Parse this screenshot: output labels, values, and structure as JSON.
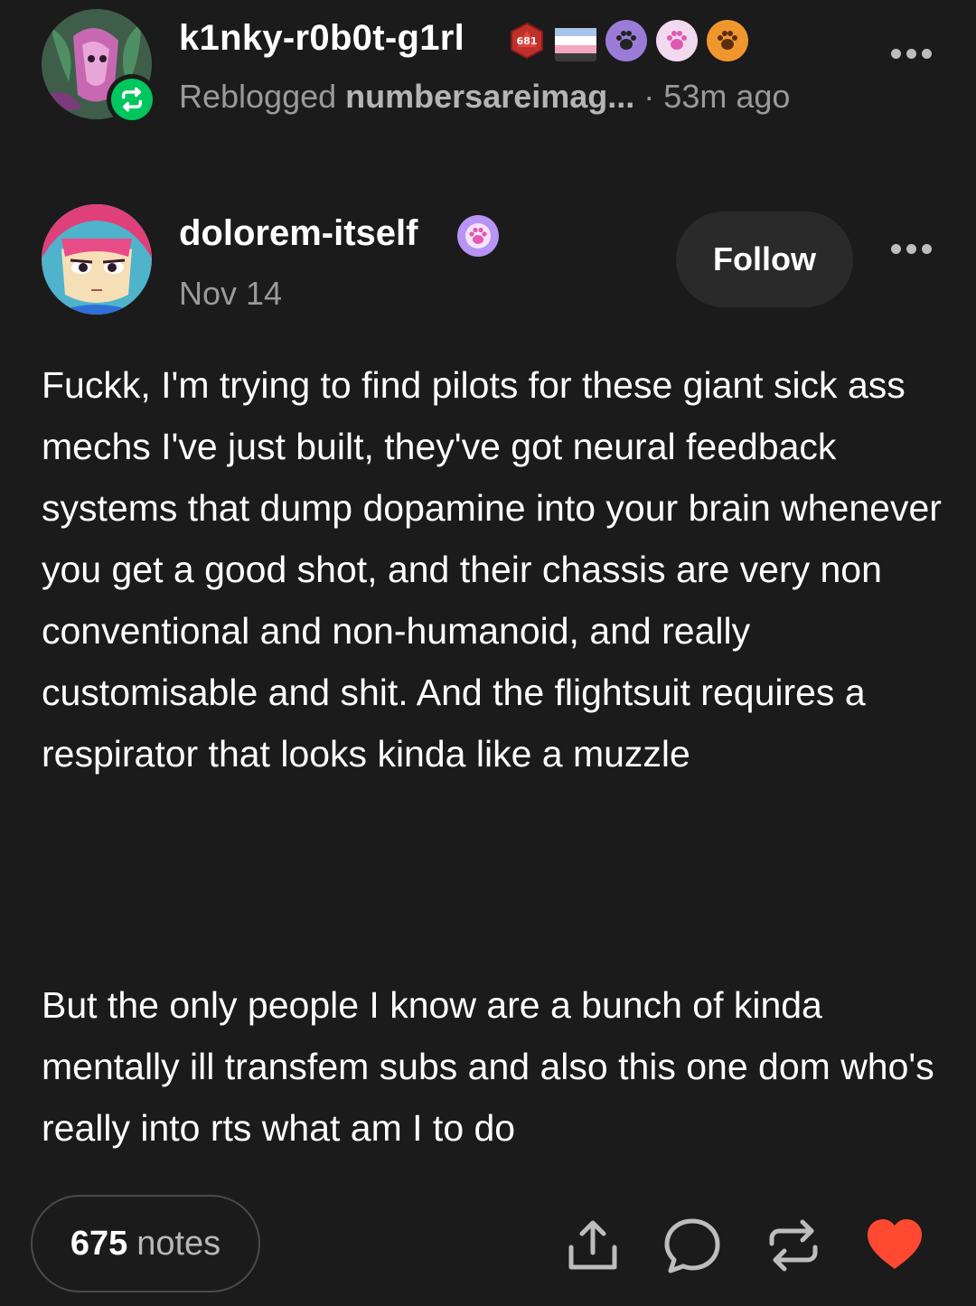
{
  "reblog_header": {
    "blog_name": "k1nky-r0b0t-g1rl",
    "reblogged_prefix": "Reblogged",
    "reblogged_from": "numbersareimag...",
    "separator": " · ",
    "time_ago": "53m ago",
    "d20_badge_text": "681"
  },
  "original_post": {
    "blog_name": "dolorem-itself",
    "date": "Nov 14",
    "follow_label": "Follow",
    "paragraphs": [
      "Fuckk, I'm trying to find pilots for these giant sick ass mechs I've just built, they've got neural feedback systems that dump dopamine into your brain whenever you get a good shot, and their chassis are very non conventional and non-humanoid, and really customisable and shit. And the flightsuit requires a respirator that looks kinda like a muzzle",
      "But the only people I know are a bunch of kinda mentally ill transfem subs and also this one dom who's really into rts what am I to do"
    ]
  },
  "footer": {
    "notes_count": "675",
    "notes_label": "notes"
  },
  "icons": {
    "reblog_badge": "reblog-icon",
    "share": "share-icon",
    "reply": "reply-icon",
    "reblog": "reblog-icon",
    "like": "heart-icon",
    "more": "more-icon",
    "paw": "paw-icon",
    "d20": "d20-icon",
    "flag": "flag-icon"
  },
  "colors": {
    "background": "#1b1b1b",
    "reblog_green": "#00c65e",
    "like_red": "#ff4930",
    "muted_text": "#9a9a9a"
  }
}
